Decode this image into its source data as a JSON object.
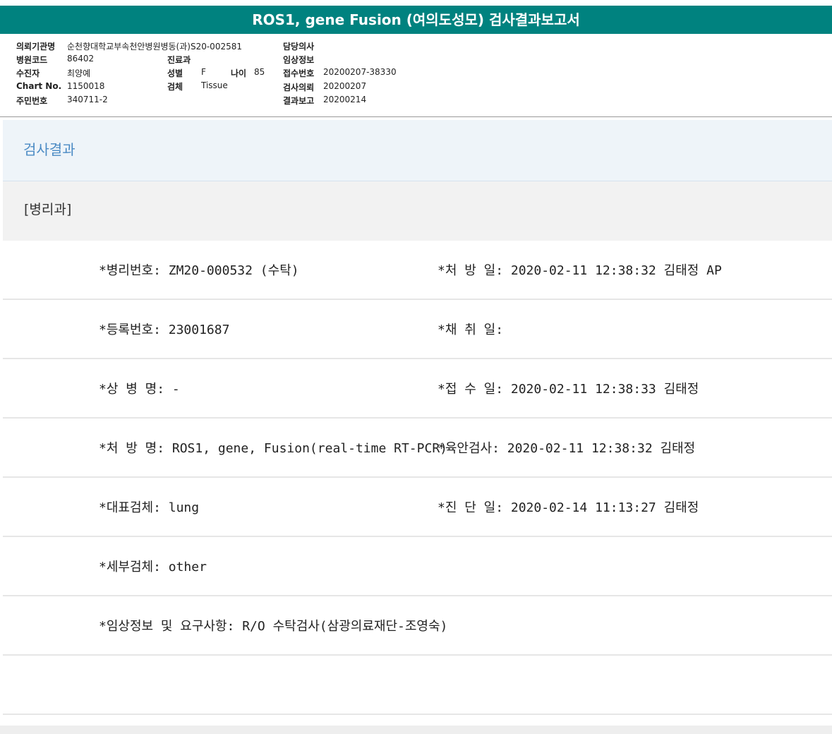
{
  "title": "ROS1, gene Fusion (여의도성모) 검사결과보고서",
  "info": {
    "c1": [
      [
        "의뢰기관명",
        "순천향대학교부속천안병원병동(과)S20-002581"
      ],
      [
        "병원코드",
        "86402"
      ],
      [
        "수진자",
        "최양예"
      ],
      [
        "Chart No.",
        "1150018"
      ],
      [
        "주민번호",
        "340711-2"
      ]
    ],
    "c2": [
      [
        "진료과",
        ""
      ],
      [
        "성별",
        "F"
      ],
      [
        "검체",
        "Tissue"
      ]
    ],
    "age": [
      "나이",
      "85"
    ],
    "c3": [
      [
        "담당의사",
        ""
      ],
      [
        "임상정보",
        ""
      ],
      [
        "접수번호",
        "20200207-38330"
      ],
      [
        "검사의뢰",
        "20200207"
      ],
      [
        "결과보고",
        "20200214"
      ]
    ]
  },
  "section_title": "검사결과",
  "group_title": "[병리과]",
  "rows": [
    {
      "left": "*병리번호: ZM20-000532 (수탁)",
      "right": "*처 방 일: 2020-02-11 12:38:32  김태정 AP"
    },
    {
      "left": "*등록번호: 23001687",
      "right": "*채 취 일:"
    },
    {
      "left": "*상 병 명: -",
      "right": "*접 수 일: 2020-02-11 12:38:33  김태정"
    },
    {
      "left": "*처 방 명: ROS1, gene, Fusion(real-time RT-PCR)",
      "right": "*육안검사: 2020-02-11 12:38:32  김태정"
    },
    {
      "left": "*대표검체: lung",
      "right": "*진 단 일: 2020-02-14 11:13:27  김태정"
    },
    {
      "left": "*세부검체: other",
      "right": ""
    },
    {
      "left": "*임상정보 및 요구사항: R/O 수탁검사(삼광의료재단-조영숙)",
      "right": ""
    },
    {
      "left": "",
      "right": ""
    }
  ]
}
